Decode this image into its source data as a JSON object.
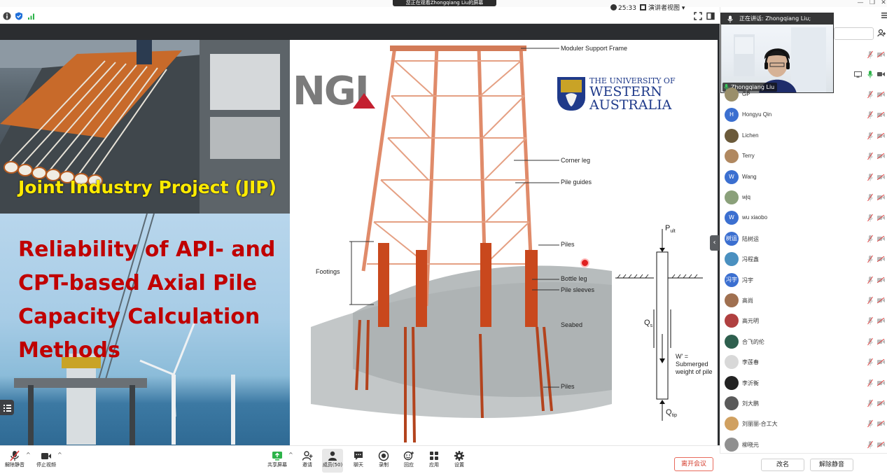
{
  "window": {
    "share_banner": "您正在观看Zhongqiang Liu的屏幕",
    "controls": [
      "—",
      "❐",
      "✕"
    ]
  },
  "topbar": {
    "timer": "25:33",
    "view_mode": "演讲者视图"
  },
  "slide": {
    "jip_title": "Joint Industry Project (JIP)",
    "main_title": "Reliability of API- and CPT-based Axial Pile Capacity Calculation Methods",
    "logo_ngi": "NGI",
    "uwa": {
      "line1": "THE UNIVERSITY OF",
      "line2": "WESTERN",
      "line3": "AUSTRALIA"
    },
    "diagram_labels": {
      "module_frame": "Moduler Support Frame",
      "corner_leg": "Corner leg",
      "pile_guides": "Pile guides",
      "piles_top": "Piles",
      "footings": "Footings",
      "bottle_leg": "Bottle leg",
      "pile_sleeves": "Pile sleeves",
      "seabed": "Seabed",
      "piles_bottom": "Piles"
    },
    "pile_labels": {
      "p_ult": "P",
      "p_ult_sub": "ult",
      "q_s": "Q",
      "q_s_sub": "s",
      "w_prime": "W' =",
      "w_desc1": "Submerged",
      "w_desc2": "weight of pile",
      "q_tip": "Q",
      "q_tip_sub": "tip"
    }
  },
  "speaker": {
    "label": "正在讲话: Zhongqiang Liu;",
    "name": "Zhongqiang Liu"
  },
  "participants": [
    {
      "name": "GP",
      "avatar": "",
      "color": "#9a8f6b"
    },
    {
      "name": "Hongyu Qin",
      "avatar": "H",
      "color": "#3b6fd0"
    },
    {
      "name": "Lichen",
      "avatar": "",
      "color": "#6b5a3a"
    },
    {
      "name": "Terry",
      "avatar": "",
      "color": "#b08860"
    },
    {
      "name": "Wang",
      "avatar": "W",
      "color": "#3b6fd0"
    },
    {
      "name": "wjq",
      "avatar": "",
      "color": "#8aa07a"
    },
    {
      "name": "wu xiaobo",
      "avatar": "W",
      "color": "#3b6fd0"
    },
    {
      "name": "陆树运",
      "avatar": "树运",
      "color": "#3b6fd0"
    },
    {
      "name": "冯程鑫",
      "avatar": "",
      "color": "#4a90c0"
    },
    {
      "name": "冯宇",
      "avatar": "冯宇",
      "color": "#3b6fd0"
    },
    {
      "name": "高尚",
      "avatar": "",
      "color": "#a07050"
    },
    {
      "name": "高元明",
      "avatar": "",
      "color": "#b04040"
    },
    {
      "name": "合飞的伦",
      "avatar": "",
      "color": "#2e5f4e"
    },
    {
      "name": "李莲春",
      "avatar": "",
      "color": "#d8d8d8"
    },
    {
      "name": "李沂衡",
      "avatar": "",
      "color": "#222222"
    },
    {
      "name": "刘大鹏",
      "avatar": "",
      "color": "#5a5a5a"
    },
    {
      "name": "刘丽丽-合工大",
      "avatar": "",
      "color": "#d0a060"
    },
    {
      "name": "柳晓元",
      "avatar": "",
      "color": "#909090"
    }
  ],
  "panel_buttons": {
    "rename": "改名",
    "unmute": "解除静音"
  },
  "toolbar": {
    "unmute": "解除静音",
    "stop_video": "停止视频",
    "share_screen": "共享屏幕",
    "invite": "邀请",
    "members": "成员(50)",
    "chat": "聊天",
    "record": "录制",
    "reactions": "回应",
    "apps": "应用",
    "settings": "设置",
    "leave": "离开会议"
  }
}
